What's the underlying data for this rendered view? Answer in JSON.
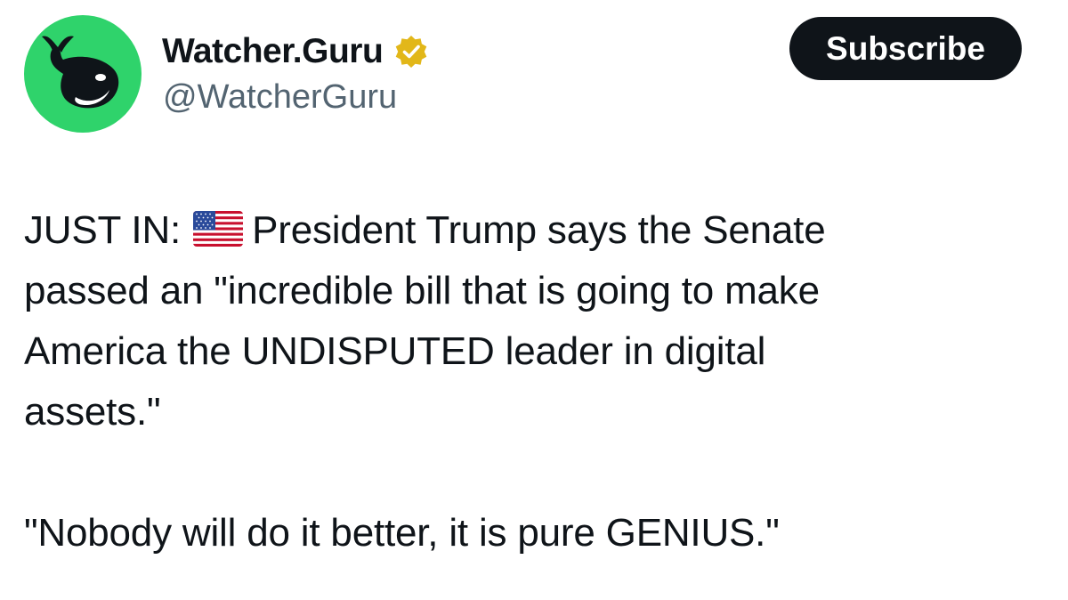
{
  "author": {
    "display_name": "Watcher.Guru",
    "handle": "@WatcherGuru",
    "verified": true,
    "verified_badge_color": "#e2b719",
    "avatar_bg": "#2fd36b",
    "avatar_icon": "whale-icon"
  },
  "actions": {
    "subscribe_label": "Subscribe"
  },
  "tweet": {
    "prefix": "JUST IN:",
    "flag_icon": "us-flag-icon",
    "line1_rest": "President Trump says the Senate",
    "line2": "passed an \"incredible bill that is going to make",
    "line3": "America the UNDISPUTED leader in digital",
    "line4": "assets.\"",
    "quote": "\"Nobody will do it better, it is pure GENIUS.\""
  },
  "colors": {
    "text": "#0f1419",
    "secondary_text": "#536471",
    "button_bg": "#0f1419",
    "button_text": "#ffffff"
  }
}
